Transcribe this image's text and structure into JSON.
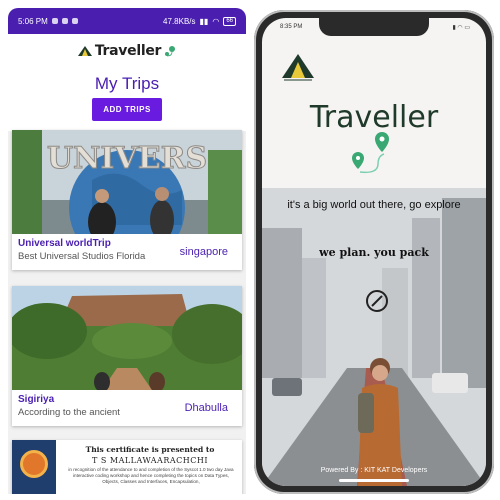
{
  "left_app": {
    "status_bar": {
      "time": "5:06 PM",
      "network": "47.8KB/s",
      "battery": "66"
    },
    "logo_text": "Traveller",
    "page_title": "My Trips",
    "add_button": "ADD TRIPS",
    "trips": [
      {
        "name": "Universal worldTrip",
        "description": "Best Universal Studios Florida",
        "location": "singapore",
        "image_sign": "UNIVERS"
      },
      {
        "name": "Sigiriya",
        "description": "According to the ancient",
        "location": "Dhabulla"
      }
    ],
    "certificate": {
      "title": "This certificate is presented to",
      "name": "T S MALLAWAARACHCHI",
      "body": "in recognition of the attendance to and completion of the Syscot 1.0 two day Java interactive coding workshop and hence completing the topics on Data Types, Objects, Classes and Interfaces, Encapsulation,"
    }
  },
  "right_app": {
    "time": "8:35 PM",
    "title": "Traveller",
    "tagline": "it's a big world out there, go explore",
    "slogan": "we plan. you pack",
    "footer": "Powered By : KIT KAT Developers"
  },
  "colors": {
    "primary": "#4a1fb0",
    "button": "#6a1be0",
    "pin_green": "#3aa873"
  }
}
